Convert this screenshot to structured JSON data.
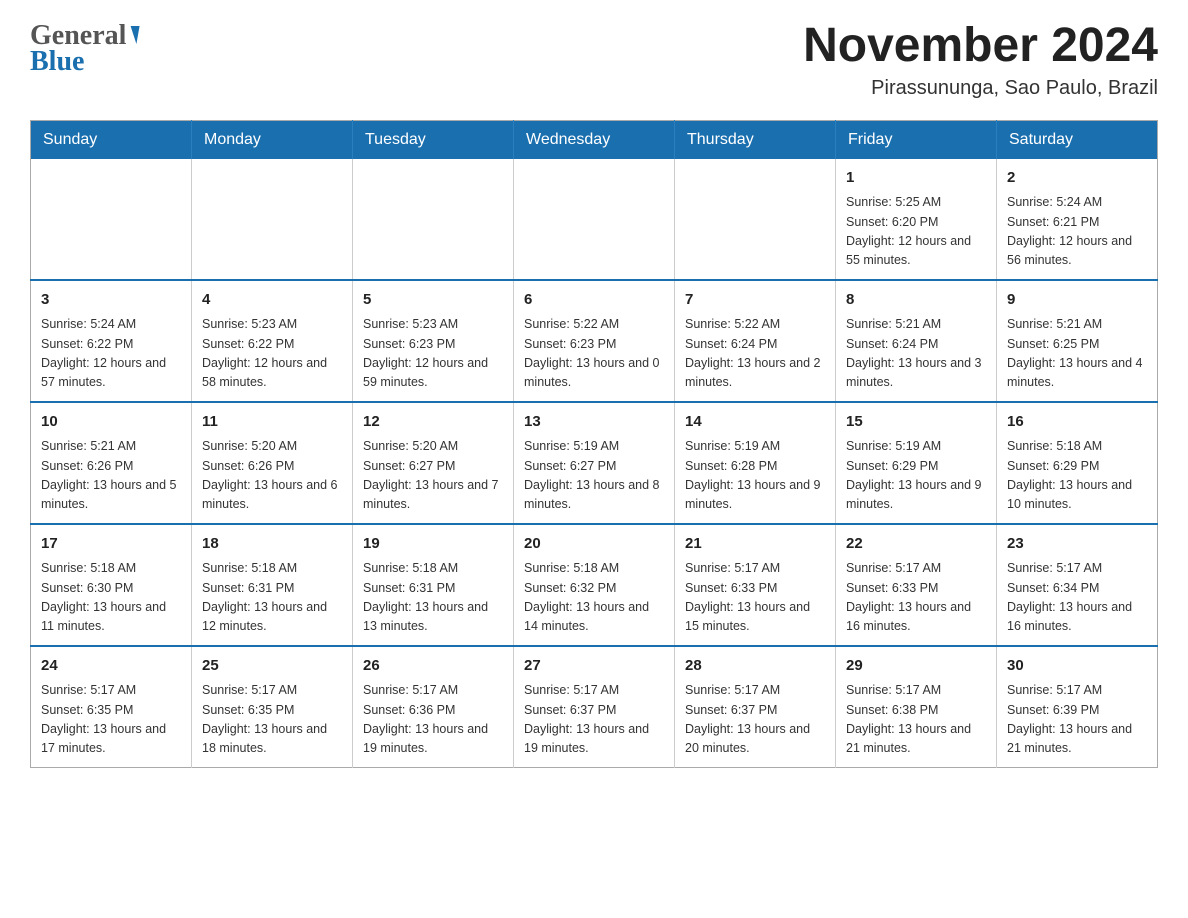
{
  "header": {
    "logo_line1": "General",
    "logo_line2": "Blue",
    "month_title": "November 2024",
    "location": "Pirassununga, Sao Paulo, Brazil"
  },
  "weekdays": [
    "Sunday",
    "Monday",
    "Tuesday",
    "Wednesday",
    "Thursday",
    "Friday",
    "Saturday"
  ],
  "weeks": [
    [
      {
        "day": "",
        "info": ""
      },
      {
        "day": "",
        "info": ""
      },
      {
        "day": "",
        "info": ""
      },
      {
        "day": "",
        "info": ""
      },
      {
        "day": "",
        "info": ""
      },
      {
        "day": "1",
        "info": "Sunrise: 5:25 AM\nSunset: 6:20 PM\nDaylight: 12 hours\nand 55 minutes."
      },
      {
        "day": "2",
        "info": "Sunrise: 5:24 AM\nSunset: 6:21 PM\nDaylight: 12 hours\nand 56 minutes."
      }
    ],
    [
      {
        "day": "3",
        "info": "Sunrise: 5:24 AM\nSunset: 6:22 PM\nDaylight: 12 hours\nand 57 minutes."
      },
      {
        "day": "4",
        "info": "Sunrise: 5:23 AM\nSunset: 6:22 PM\nDaylight: 12 hours\nand 58 minutes."
      },
      {
        "day": "5",
        "info": "Sunrise: 5:23 AM\nSunset: 6:23 PM\nDaylight: 12 hours\nand 59 minutes."
      },
      {
        "day": "6",
        "info": "Sunrise: 5:22 AM\nSunset: 6:23 PM\nDaylight: 13 hours\nand 0 minutes."
      },
      {
        "day": "7",
        "info": "Sunrise: 5:22 AM\nSunset: 6:24 PM\nDaylight: 13 hours\nand 2 minutes."
      },
      {
        "day": "8",
        "info": "Sunrise: 5:21 AM\nSunset: 6:24 PM\nDaylight: 13 hours\nand 3 minutes."
      },
      {
        "day": "9",
        "info": "Sunrise: 5:21 AM\nSunset: 6:25 PM\nDaylight: 13 hours\nand 4 minutes."
      }
    ],
    [
      {
        "day": "10",
        "info": "Sunrise: 5:21 AM\nSunset: 6:26 PM\nDaylight: 13 hours\nand 5 minutes."
      },
      {
        "day": "11",
        "info": "Sunrise: 5:20 AM\nSunset: 6:26 PM\nDaylight: 13 hours\nand 6 minutes."
      },
      {
        "day": "12",
        "info": "Sunrise: 5:20 AM\nSunset: 6:27 PM\nDaylight: 13 hours\nand 7 minutes."
      },
      {
        "day": "13",
        "info": "Sunrise: 5:19 AM\nSunset: 6:27 PM\nDaylight: 13 hours\nand 8 minutes."
      },
      {
        "day": "14",
        "info": "Sunrise: 5:19 AM\nSunset: 6:28 PM\nDaylight: 13 hours\nand 9 minutes."
      },
      {
        "day": "15",
        "info": "Sunrise: 5:19 AM\nSunset: 6:29 PM\nDaylight: 13 hours\nand 9 minutes."
      },
      {
        "day": "16",
        "info": "Sunrise: 5:18 AM\nSunset: 6:29 PM\nDaylight: 13 hours\nand 10 minutes."
      }
    ],
    [
      {
        "day": "17",
        "info": "Sunrise: 5:18 AM\nSunset: 6:30 PM\nDaylight: 13 hours\nand 11 minutes."
      },
      {
        "day": "18",
        "info": "Sunrise: 5:18 AM\nSunset: 6:31 PM\nDaylight: 13 hours\nand 12 minutes."
      },
      {
        "day": "19",
        "info": "Sunrise: 5:18 AM\nSunset: 6:31 PM\nDaylight: 13 hours\nand 13 minutes."
      },
      {
        "day": "20",
        "info": "Sunrise: 5:18 AM\nSunset: 6:32 PM\nDaylight: 13 hours\nand 14 minutes."
      },
      {
        "day": "21",
        "info": "Sunrise: 5:17 AM\nSunset: 6:33 PM\nDaylight: 13 hours\nand 15 minutes."
      },
      {
        "day": "22",
        "info": "Sunrise: 5:17 AM\nSunset: 6:33 PM\nDaylight: 13 hours\nand 16 minutes."
      },
      {
        "day": "23",
        "info": "Sunrise: 5:17 AM\nSunset: 6:34 PM\nDaylight: 13 hours\nand 16 minutes."
      }
    ],
    [
      {
        "day": "24",
        "info": "Sunrise: 5:17 AM\nSunset: 6:35 PM\nDaylight: 13 hours\nand 17 minutes."
      },
      {
        "day": "25",
        "info": "Sunrise: 5:17 AM\nSunset: 6:35 PM\nDaylight: 13 hours\nand 18 minutes."
      },
      {
        "day": "26",
        "info": "Sunrise: 5:17 AM\nSunset: 6:36 PM\nDaylight: 13 hours\nand 19 minutes."
      },
      {
        "day": "27",
        "info": "Sunrise: 5:17 AM\nSunset: 6:37 PM\nDaylight: 13 hours\nand 19 minutes."
      },
      {
        "day": "28",
        "info": "Sunrise: 5:17 AM\nSunset: 6:37 PM\nDaylight: 13 hours\nand 20 minutes."
      },
      {
        "day": "29",
        "info": "Sunrise: 5:17 AM\nSunset: 6:38 PM\nDaylight: 13 hours\nand 21 minutes."
      },
      {
        "day": "30",
        "info": "Sunrise: 5:17 AM\nSunset: 6:39 PM\nDaylight: 13 hours\nand 21 minutes."
      }
    ]
  ]
}
